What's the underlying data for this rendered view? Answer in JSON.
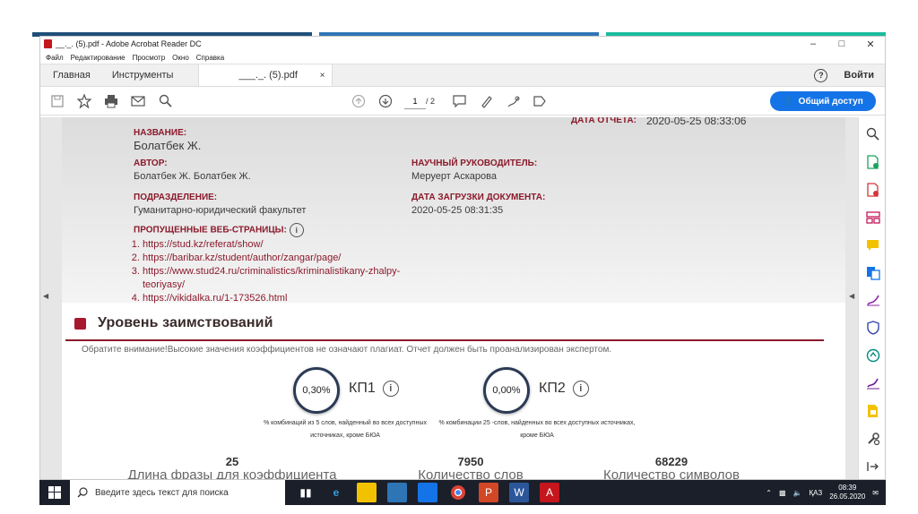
{
  "colors": {
    "stripe_dark": "#1f4e79",
    "stripe_blue": "#2e75b6",
    "stripe_teal": "#1abc9c",
    "accent": "#8b1a2b",
    "share": "#1473e6"
  },
  "window": {
    "title": "__._. (5).pdf - Adobe Acrobat Reader DC",
    "controls": [
      "–",
      "□",
      "✕"
    ]
  },
  "menu": [
    "Файл",
    "Редактирование",
    "Просмотр",
    "Окно",
    "Справка"
  ],
  "tabs": {
    "home": "Главная",
    "tools": "Инструменты",
    "doc": "___._. (5).pdf",
    "close": "×",
    "help": "?",
    "signin": "Войти"
  },
  "toolbar": {
    "page_current": "1",
    "page_total": "/ 2",
    "share_label": "Общий доступ"
  },
  "report": {
    "date_label": "ДАТА ОТЧЕТА:",
    "date_value": "2020-05-25 08:33:06",
    "title_label": "НАЗВАНИЕ:",
    "title_value": "Болатбек Ж.",
    "author_label": "АВТОР:",
    "author_value": "Болатбек Ж. Болатбек Ж.",
    "supervisor_label": "НАУЧНЫЙ РУКОВОДИТЕЛЬ:",
    "supervisor_value": "Меруерт Аскарова",
    "dept_label": "ПОДРАЗДЕЛЕНИЕ:",
    "dept_value": "Гуманитарно-юридический факультет",
    "upload_label": "ДАТА ЗАГРУЗКИ ДОКУМЕНТА:",
    "upload_value": "2020-05-25 08:31:35",
    "skipped_label": "ПРОПУЩЕННЫЕ ВЕБ-СТРАНИЦЫ:",
    "links": [
      "https://stud.kz/referat/show/",
      "https://baribar.kz/student/author/zangar/page/",
      "https://www.stud24.ru/criminalistics/kriminalistikany-zhalpy-teoriyasy/",
      "https://vikidalka.ru/1-173526.html"
    ]
  },
  "borrowing": {
    "title": "Уровень заимствований",
    "notice": "Обратите внимание!Высокие значения коэффициентов не означают плагиат. Отчет должен быть проанализирован экспертом.",
    "kp1": {
      "value": "0,30%",
      "label": "КП1",
      "note": "% комбинаций из 5 слов, найденный во всех доступных источниках, кроме БЮА"
    },
    "kp2": {
      "value": "0,00%",
      "label": "КП2",
      "note": "% комбинации 25 -слов, найденных во всех доступных источниках, кроме БЮА"
    },
    "stats": [
      {
        "value": "25",
        "label": "Длина фразы для коэффициента"
      },
      {
        "value": "7950",
        "label": "Количество слов"
      },
      {
        "value": "68229",
        "label": "Количество символов"
      }
    ]
  },
  "taskbar": {
    "search_placeholder": "Введите здесь текст для поиска",
    "lang": "ҚАЗ",
    "time": "08:39",
    "date": "26.05.2020"
  }
}
